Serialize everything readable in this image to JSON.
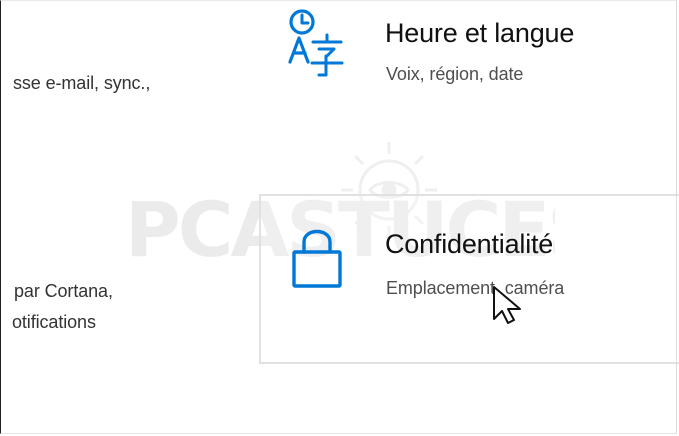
{
  "settings": {
    "left_fragments": {
      "account": "sse e-mail, sync.,",
      "cortana": "par Cortana,",
      "notifications": "otifications"
    },
    "time_language": {
      "icon": "time-language-icon",
      "title": "Heure et langue",
      "subtitle": "Voix, région, date"
    },
    "privacy": {
      "icon": "lock-icon",
      "title": "Confidentialité",
      "subtitle": "Emplacement, caméra"
    }
  },
  "watermark": {
    "text": "PCASTUCES"
  },
  "colors": {
    "accent": "#0078d7",
    "text": "#111111",
    "subtle_text": "#4f4f4f",
    "selected_border": "#e1e1e1"
  },
  "cursor": {
    "icon": "mouse-pointer-icon"
  }
}
